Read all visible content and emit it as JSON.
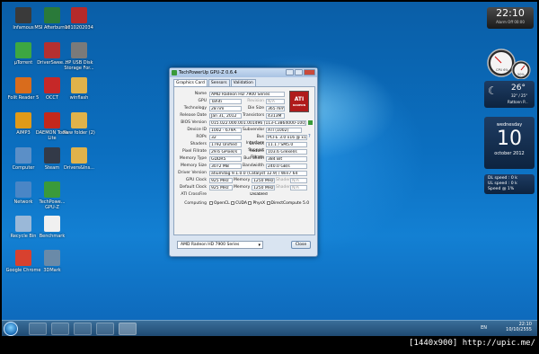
{
  "desktop": {
    "icons": [
      {
        "label": "Infamous",
        "color": "#3a3a3a"
      },
      {
        "label": "MSI Afterburner",
        "color": "#2a7a3a"
      },
      {
        "label": "1010202034",
        "color": "#b52a2a"
      },
      {
        "label": "µTorrent",
        "color": "#3da742"
      },
      {
        "label": "DriverSwee...",
        "color": "#b53030"
      },
      {
        "label": "HP USB Disk Storage For...",
        "color": "#7a7a7a"
      },
      {
        "label": "Folit Reader 5",
        "color": "#d96c1c"
      },
      {
        "label": "OCCT",
        "color": "#c62828"
      },
      {
        "label": "winflash",
        "color": "#e0b24a"
      },
      {
        "label": "AIMP3",
        "color": "#e09a18"
      },
      {
        "label": "DAEMON Tools Lite",
        "color": "#c4281c"
      },
      {
        "label": "New folder (2)",
        "color": "#e0b24a"
      },
      {
        "label": "Computer",
        "color": "#5b8fc7"
      },
      {
        "label": "Steam",
        "color": "#333a48"
      },
      {
        "label": "Drivers&Ins...",
        "color": "#e0b24a"
      },
      {
        "label": "Network",
        "color": "#4a86c6"
      },
      {
        "label": "TechPowe... GPU-Z",
        "color": "#3a9a3a"
      },
      {
        "label": "Recycle Bin",
        "color": "#9ab8d8"
      },
      {
        "label": "Benchmark",
        "color": "#f0f0f0"
      },
      {
        "label": "Google Chrome",
        "color": "#d8412f"
      },
      {
        "label": "3DMark",
        "color": "#6a8aa8"
      }
    ]
  },
  "gadgets": {
    "clock_time": "22:10",
    "clock_sub": "Alarm Off      00:00",
    "weather_temp": "26°",
    "weather_range": "32° / 25°",
    "weather_city": "Rattonn P...",
    "cal_day": "wednesday",
    "cal_date": "10",
    "cal_month": "october 2012",
    "net_dl": "DL speed : 0 k",
    "net_ul": "UL speed : 0 k",
    "net_speed": "Speed @ 1%",
    "meter_cpu": "CPU 6%",
    "meter_ram": "50%"
  },
  "window": {
    "title": "TechPowerUp GPU-Z 0.6.4",
    "tabs": [
      "Graphics Card",
      "Sensors",
      "Validation"
    ],
    "logo_text": "ATI",
    "logo_sub": "RADEON",
    "fields": {
      "name": {
        "label": "Name",
        "value": "AMD Radeon HD 7900 Series"
      },
      "gpu": {
        "label": "GPU",
        "value": "Tahiti"
      },
      "revision": {
        "label": "Revision",
        "value": "N/A"
      },
      "technology": {
        "label": "Technology",
        "value": "28 nm"
      },
      "die_size": {
        "label": "Die Size",
        "value": "365 mm²"
      },
      "release_date": {
        "label": "Release Date",
        "value": "Jan 31, 2012"
      },
      "transistors": {
        "label": "Transistors",
        "value": "4313M"
      },
      "bios": {
        "label": "BIOS Version",
        "value": "015.022.000.001.001496 (113-C3864000-100)"
      },
      "device_id": {
        "label": "Device ID",
        "value": "1002 - 679A"
      },
      "subvendor": {
        "label": "Subvendor",
        "value": "ATI (1002)"
      },
      "rops": {
        "label": "ROPs",
        "value": "32"
      },
      "bus_interface": {
        "label": "Bus Interface",
        "value": "PCI-E 3.0 x16 @ x16 1.1"
      },
      "shaders": {
        "label": "Shaders",
        "value": "1792 Unified"
      },
      "directx": {
        "label": "DirectX Support",
        "value": "11.1 / SM5.0"
      },
      "pixel_fillrate": {
        "label": "Pixel Fillrate",
        "value": "29.6 GPixel/s"
      },
      "texture_fillrate": {
        "label": "Texture Fillrate",
        "value": "103.6 GTexel/s"
      },
      "memory_type": {
        "label": "Memory Type",
        "value": "GDDR5"
      },
      "bus_width": {
        "label": "Bus Width",
        "value": "384 Bit"
      },
      "memory_size": {
        "label": "Memory Size",
        "value": "3072 MB"
      },
      "bandwidth": {
        "label": "Bandwidth",
        "value": "240.0 GB/s"
      },
      "driver": {
        "label": "Driver Version",
        "value": "atiumdag 9.1.0.0 (Catalyst 12.9) / Win7 64"
      },
      "gpu_clock": {
        "label": "GPU Clock",
        "value": "925 MHz"
      },
      "memory_clock_label": "Memory",
      "gpu_memory": "1250 MHz",
      "shader_label": "Shader",
      "shader_value": "N/A",
      "default_clock": {
        "label": "Default Clock",
        "value": "925 MHz"
      },
      "default_memory": "1250 MHz",
      "crossfire": {
        "label": "ATI CrossFire",
        "value": "Disabled"
      },
      "computing": {
        "label": "Computing",
        "items": [
          "OpenCL",
          "CUDA",
          "PhysX",
          "DirectCompute 5.0"
        ]
      }
    },
    "gpu_select": "AMD Radeon HD 7900 Series",
    "close_label": "Close"
  },
  "taskbar": {
    "lang": "EN",
    "time": "22:10",
    "date": "10/10/2555"
  },
  "caption": "[1440x900] http://upic.me/"
}
